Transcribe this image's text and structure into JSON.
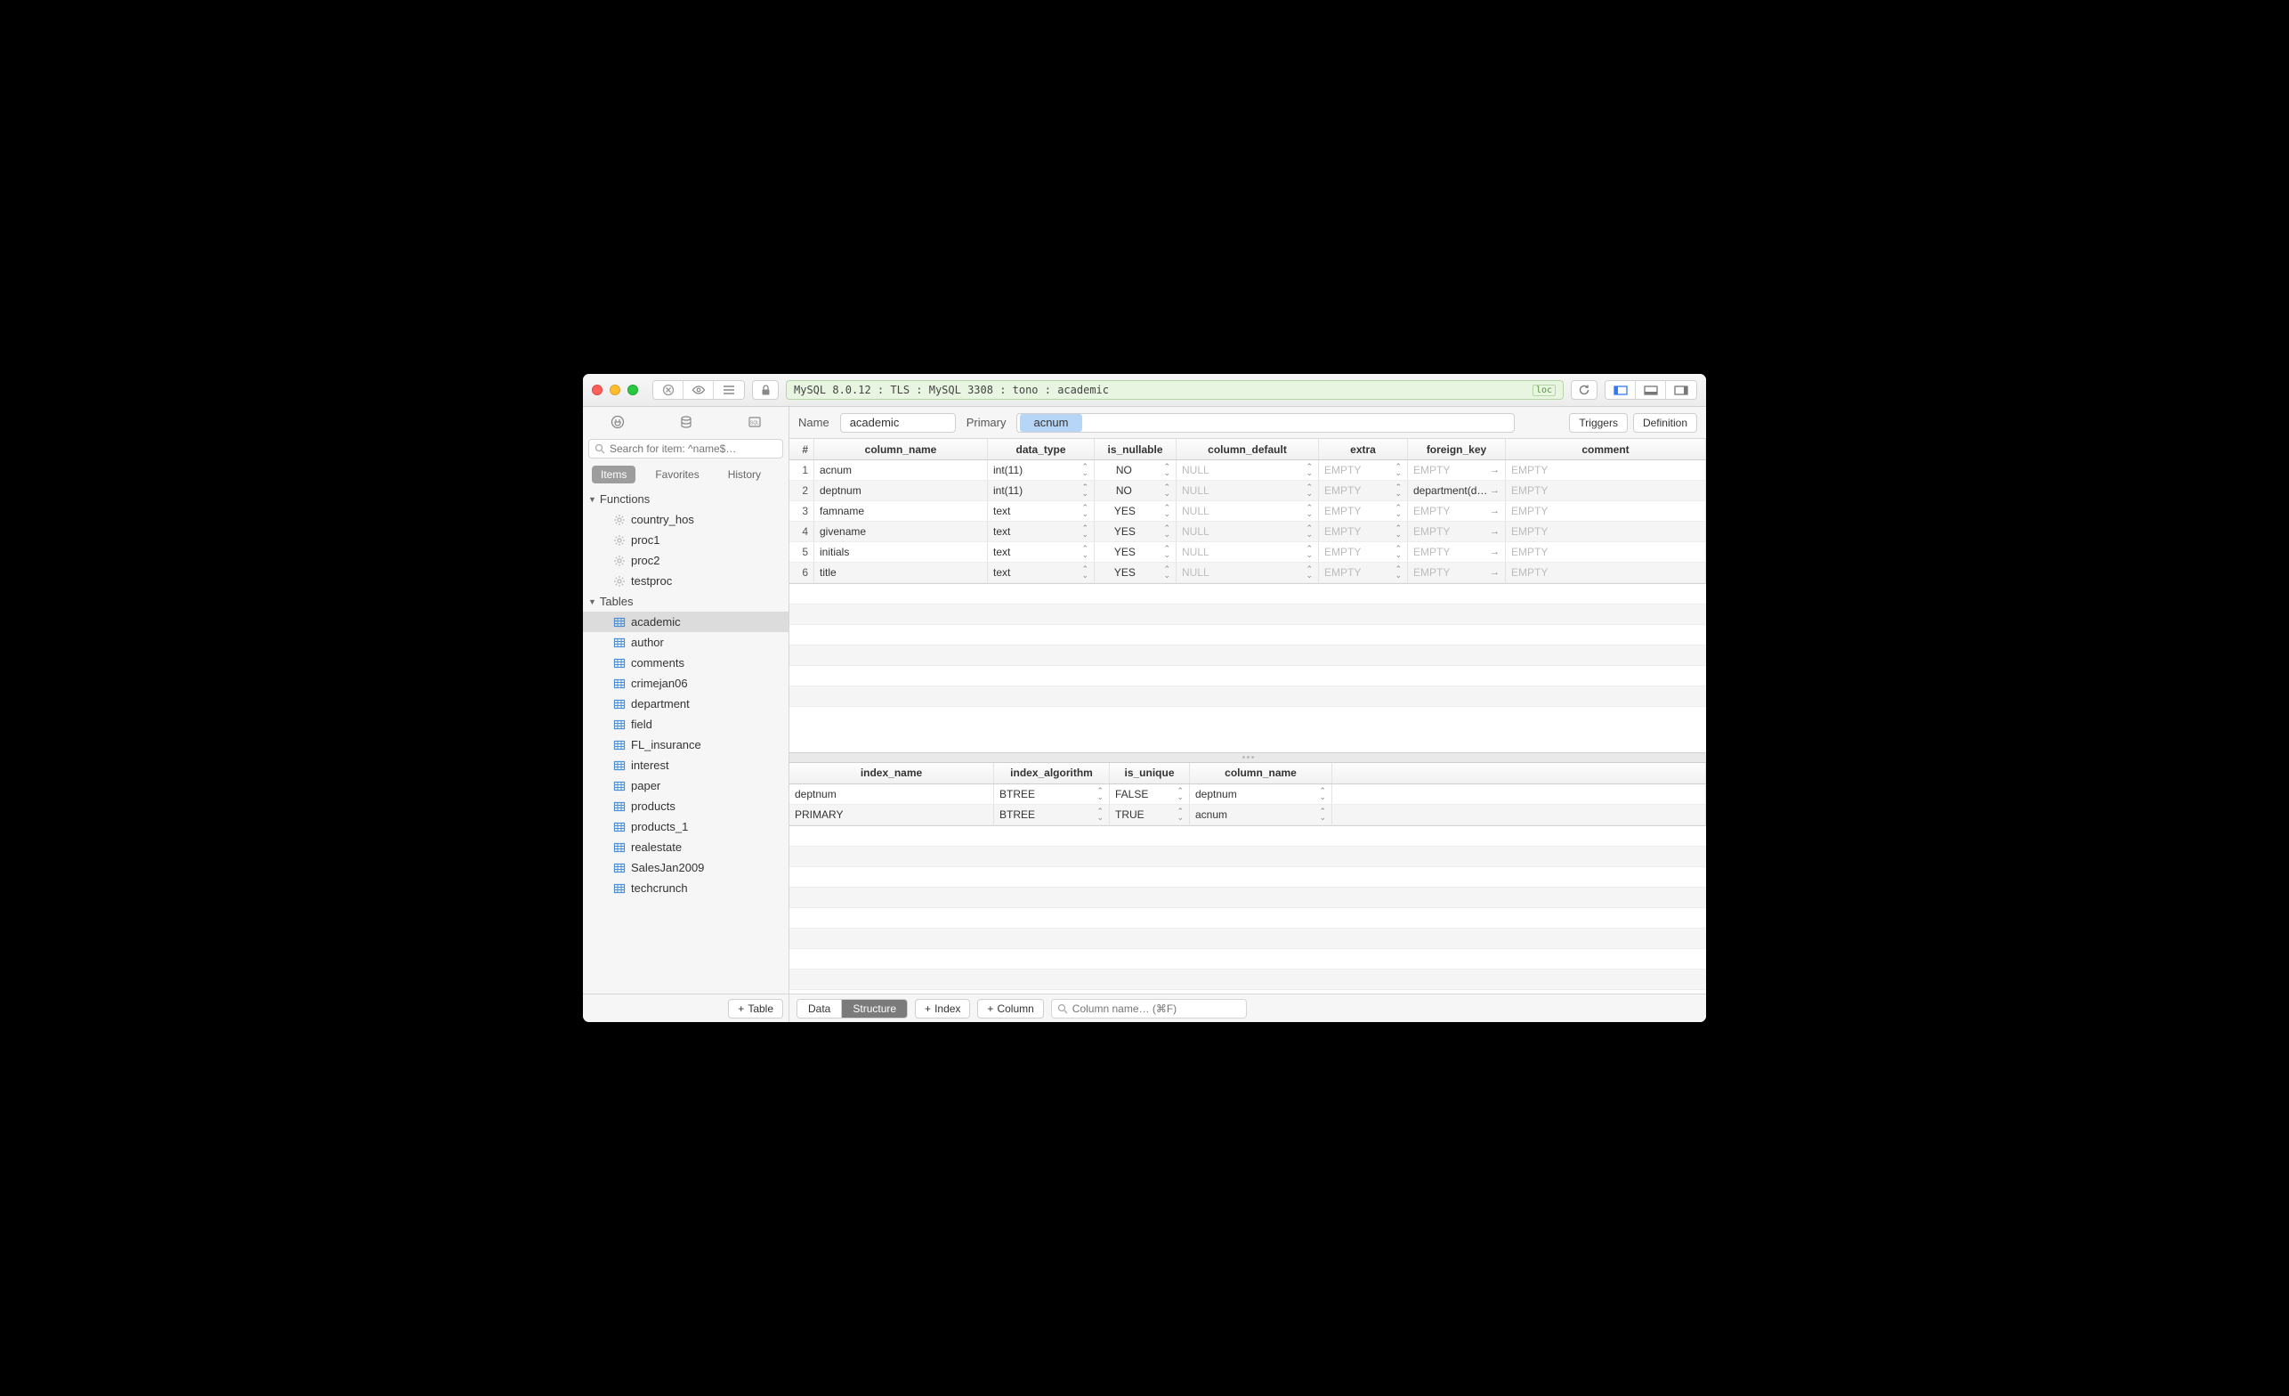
{
  "titlebar": {
    "connection": "MySQL 8.0.12 : TLS : MySQL 3308 : tono : academic",
    "loc_tag": "loc"
  },
  "sidebar": {
    "search_placeholder": "Search for item: ^name$…",
    "segments": [
      "Items",
      "Favorites",
      "History"
    ],
    "functions_label": "Functions",
    "functions": [
      "country_hos",
      "proc1",
      "proc2",
      "testproc"
    ],
    "tables_label": "Tables",
    "tables": [
      "academic",
      "author",
      "comments",
      "crimejan06",
      "department",
      "field",
      "FL_insurance",
      "interest",
      "paper",
      "products",
      "products_1",
      "realestate",
      "SalesJan2009",
      "techcrunch"
    ],
    "selected_table": "academic",
    "add_table": "Table"
  },
  "meta": {
    "name_label": "Name",
    "name_value": "academic",
    "primary_label": "Primary",
    "primary_value": "acnum",
    "triggers": "Triggers",
    "definition": "Definition"
  },
  "columns_grid": {
    "headers": [
      "#",
      "column_name",
      "data_type",
      "is_nullable",
      "column_default",
      "extra",
      "foreign_key",
      "comment"
    ],
    "rows": [
      {
        "n": "1",
        "name": "acnum",
        "type": "int(11)",
        "nullable": "NO",
        "def": "NULL",
        "extra": "EMPTY",
        "fk": "EMPTY",
        "comment": "EMPTY"
      },
      {
        "n": "2",
        "name": "deptnum",
        "type": "int(11)",
        "nullable": "NO",
        "def": "NULL",
        "extra": "EMPTY",
        "fk": "department(d…",
        "comment": "EMPTY"
      },
      {
        "n": "3",
        "name": "famname",
        "type": "text",
        "nullable": "YES",
        "def": "NULL",
        "extra": "EMPTY",
        "fk": "EMPTY",
        "comment": "EMPTY"
      },
      {
        "n": "4",
        "name": "givename",
        "type": "text",
        "nullable": "YES",
        "def": "NULL",
        "extra": "EMPTY",
        "fk": "EMPTY",
        "comment": "EMPTY"
      },
      {
        "n": "5",
        "name": "initials",
        "type": "text",
        "nullable": "YES",
        "def": "NULL",
        "extra": "EMPTY",
        "fk": "EMPTY",
        "comment": "EMPTY"
      },
      {
        "n": "6",
        "name": "title",
        "type": "text",
        "nullable": "YES",
        "def": "NULL",
        "extra": "EMPTY",
        "fk": "EMPTY",
        "comment": "EMPTY"
      }
    ]
  },
  "index_grid": {
    "headers": [
      "index_name",
      "index_algorithm",
      "is_unique",
      "column_name"
    ],
    "rows": [
      {
        "name": "deptnum",
        "alg": "BTREE",
        "uniq": "FALSE",
        "col": "deptnum"
      },
      {
        "name": "PRIMARY",
        "alg": "BTREE",
        "uniq": "TRUE",
        "col": "acnum"
      }
    ]
  },
  "footer": {
    "tab_data": "Data",
    "tab_structure": "Structure",
    "add_index": "Index",
    "add_column": "Column",
    "filter_placeholder": "Column name… (⌘F)"
  }
}
